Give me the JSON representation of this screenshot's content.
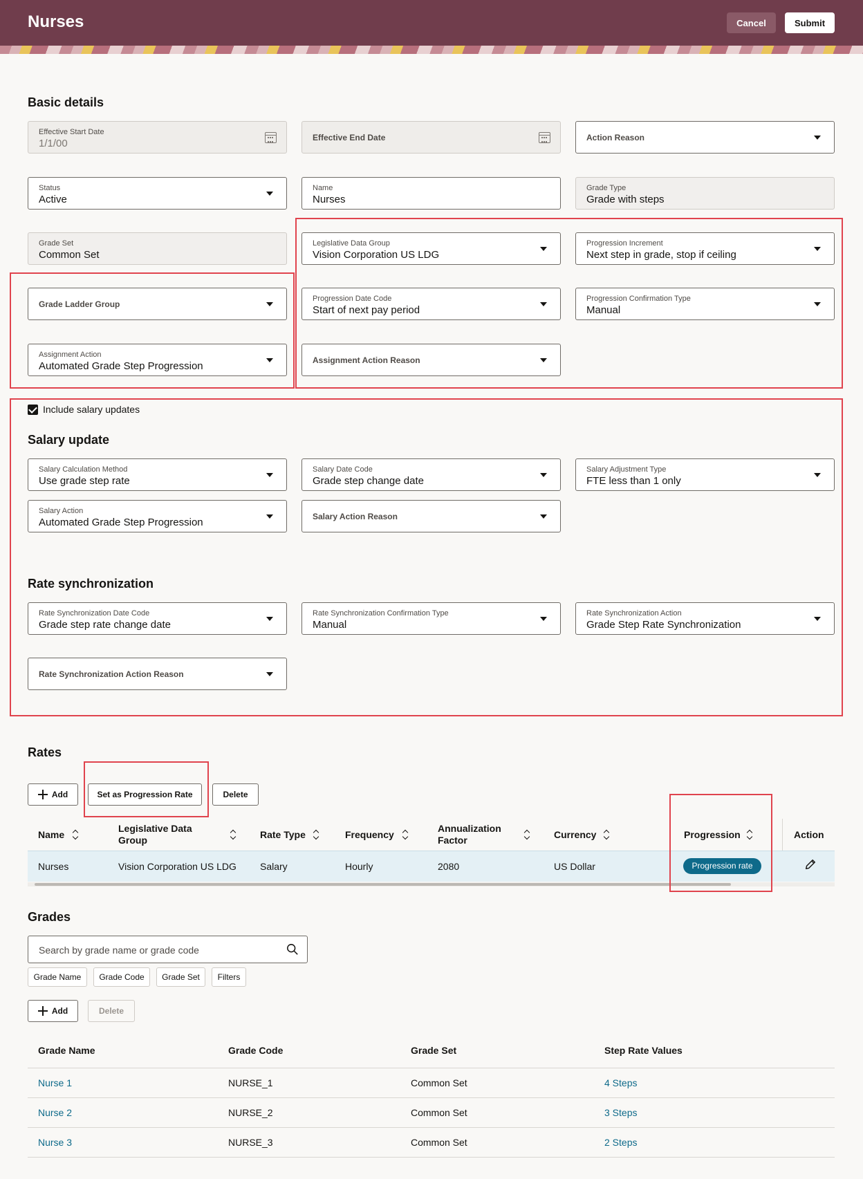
{
  "header": {
    "title": "Nurses",
    "cancel_label": "Cancel",
    "submit_label": "Submit"
  },
  "basic": {
    "title": "Basic details",
    "effective_start": {
      "label": "Effective Start Date",
      "value": "1/1/00"
    },
    "effective_end": {
      "label": "Effective End Date"
    },
    "action_reason": {
      "label": "Action Reason"
    },
    "status": {
      "label": "Status",
      "value": "Active"
    },
    "name": {
      "label": "Name",
      "value": "Nurses"
    },
    "grade_type": {
      "label": "Grade Type",
      "value": "Grade with steps"
    },
    "grade_set": {
      "label": "Grade Set",
      "value": "Common Set"
    },
    "ldg": {
      "label": "Legislative Data Group",
      "value": "Vision Corporation US LDG"
    },
    "progression_increment": {
      "label": "Progression Increment",
      "value": "Next step in grade, stop if ceiling"
    },
    "grade_ladder_group": {
      "label": "Grade Ladder Group"
    },
    "progression_date_code": {
      "label": "Progression Date Code",
      "value": "Start of next pay period"
    },
    "progression_confirmation": {
      "label": "Progression Confirmation Type",
      "value": "Manual"
    },
    "assignment_action": {
      "label": "Assignment Action",
      "value": "Automated Grade Step Progression"
    },
    "assignment_action_reason": {
      "label": "Assignment Action Reason"
    }
  },
  "include_salary_label": "Include salary updates",
  "salary": {
    "title": "Salary update",
    "calc_method": {
      "label": "Salary Calculation Method",
      "value": "Use grade step rate"
    },
    "date_code": {
      "label": "Salary Date Code",
      "value": "Grade step change date"
    },
    "adjustment_type": {
      "label": "Salary Adjustment Type",
      "value": "FTE less than 1 only"
    },
    "action": {
      "label": "Salary Action",
      "value": "Automated Grade Step Progression"
    },
    "action_reason": {
      "label": "Salary Action Reason"
    }
  },
  "ratesync": {
    "title": "Rate synchronization",
    "date_code": {
      "label": "Rate Synchronization Date Code",
      "value": "Grade step rate change date"
    },
    "confirmation": {
      "label": "Rate Synchronization Confirmation Type",
      "value": "Manual"
    },
    "action": {
      "label": "Rate Synchronization Action",
      "value": "Grade Step Rate Synchronization"
    },
    "action_reason": {
      "label": "Rate Synchronization Action Reason"
    }
  },
  "rates": {
    "title": "Rates",
    "add_label": "Add",
    "set_progression_label": "Set as Progression Rate",
    "delete_label": "Delete",
    "columns": [
      "Name",
      "Legislative Data",
      "Group",
      "Rate Type",
      "Frequency",
      "Annualization",
      "Factor",
      "Currency",
      "Progression",
      "Action"
    ],
    "row": {
      "name": "Nurses",
      "ldg": "Vision Corporation US LDG",
      "rate_type": "Salary",
      "frequency": "Hourly",
      "factor": "2080",
      "currency": "US Dollar",
      "progression": "Progression rate"
    }
  },
  "grades": {
    "title": "Grades",
    "search_placeholder": "Search by grade name or grade code",
    "chips": [
      "Grade Name",
      "Grade Code",
      "Grade Set",
      "Filters"
    ],
    "add_label": "Add",
    "delete_label": "Delete",
    "columns": [
      "Grade Name",
      "Grade Code",
      "Grade Set",
      "Step Rate Values"
    ],
    "rows": [
      {
        "name": "Nurse 1",
        "code": "NURSE_1",
        "set": "Common Set",
        "steps": "4 Steps"
      },
      {
        "name": "Nurse 2",
        "code": "NURSE_2",
        "set": "Common Set",
        "steps": "3 Steps"
      },
      {
        "name": "Nurse 3",
        "code": "NURSE_3",
        "set": "Common Set",
        "steps": "2 Steps"
      }
    ]
  }
}
